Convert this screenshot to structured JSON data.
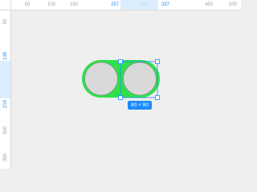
{
  "ruler": {
    "horizontal": [
      "50",
      "100",
      "150",
      "257",
      "300",
      "337",
      "450",
      "500"
    ],
    "horizontal_highlight": [
      "257",
      "337"
    ],
    "vertical": [
      "50",
      "138",
      "219",
      "300",
      "350"
    ],
    "vertical_highlight": [
      "138",
      "219"
    ]
  },
  "selection": {
    "size_label": "80 × 80"
  },
  "colors": {
    "accent": "#1a8cff",
    "stroke": "#2ee14a",
    "fill": "#d9d9d9",
    "canvas": "#efefef"
  }
}
